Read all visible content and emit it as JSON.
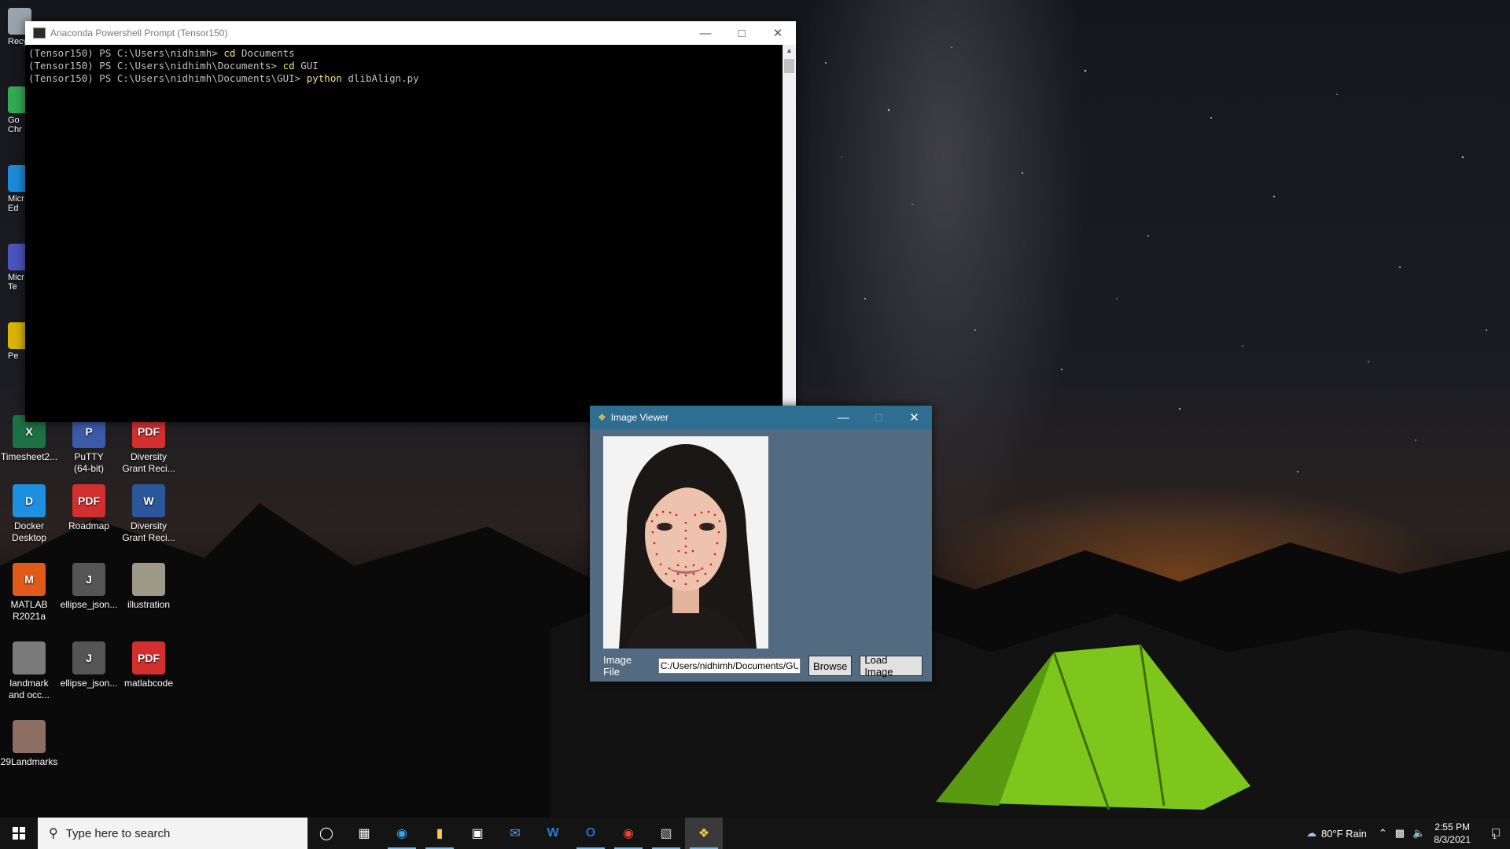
{
  "desktop": {
    "partial_icons": [
      {
        "name": "recycle-bin",
        "label": "Recy",
        "color": "#9aa4ad"
      },
      {
        "name": "google-chrome",
        "label": "Go\nChr",
        "color": "#34a853"
      },
      {
        "name": "microsoft-edge",
        "label": "Micr\nEd",
        "color": "#1b8ad8"
      },
      {
        "name": "microsoft-teams",
        "label": "Micr\nTe",
        "color": "#4b53bc"
      },
      {
        "name": "pe-app",
        "label": "Pe",
        "color": "#d9b400"
      }
    ],
    "icons": [
      {
        "label": "Timesheet2...",
        "glyph": "X",
        "color": "#1e7145"
      },
      {
        "label": "PuTTY\n(64-bit)",
        "glyph": "P",
        "color": "#3b5ba9"
      },
      {
        "label": "Diversity\nGrant Reci...",
        "glyph": "PDF",
        "color": "#d32f2f"
      },
      {
        "label": "Docker\nDesktop",
        "glyph": "D",
        "color": "#1d91e0"
      },
      {
        "label": "Roadmap",
        "glyph": "PDF",
        "color": "#d32f2f"
      },
      {
        "label": "Diversity\nGrant Reci...",
        "glyph": "W",
        "color": "#2b579a"
      },
      {
        "label": "MATLAB\nR2021a",
        "glyph": "M",
        "color": "#e05a1a"
      },
      {
        "label": "ellipse_json...",
        "glyph": "J",
        "color": "#555555"
      },
      {
        "label": "illustration",
        "glyph": "",
        "color": "#9c9a86"
      },
      {
        "label": "landmark\nand occ...",
        "glyph": "",
        "color": "#7a7a7a"
      },
      {
        "label": "ellipse_json...",
        "glyph": "J",
        "color": "#555555"
      },
      {
        "label": "matlabcode",
        "glyph": "PDF",
        "color": "#d32f2f"
      },
      {
        "label": "29Landmarks",
        "glyph": "",
        "color": "#8d6e63"
      }
    ]
  },
  "terminal": {
    "title": "Anaconda Powershell Prompt (Tensor150)",
    "lines": [
      {
        "prompt": "(Tensor150) PS C:\\Users\\nidhimh> ",
        "cmd": "cd",
        "arg": " Documents"
      },
      {
        "prompt": "(Tensor150) PS C:\\Users\\nidhimh\\Documents> ",
        "cmd": "cd",
        "arg": " GUI"
      },
      {
        "prompt": "(Tensor150) PS C:\\Users\\nidhimh\\Documents\\GUI> ",
        "cmd": "python",
        "arg": " dlibAlign.py"
      }
    ]
  },
  "viewer": {
    "title": "Image Viewer",
    "image_file_label": "Image File",
    "image_file_value": "C:/Users/nidhimh/Documents/GUI/",
    "browse_label": "Browse",
    "load_label": "Load Image"
  },
  "taskbar": {
    "search_placeholder": "Type here to search",
    "apps": [
      "edge-icon",
      "file-explorer-icon",
      "store-icon",
      "mail-icon",
      "word-icon",
      "outlook-icon",
      "chrome-icon",
      "terminal-icon",
      "python-icon"
    ],
    "weather": "80°F  Rain",
    "time": "2:55 PM",
    "date": "8/3/2021",
    "notification_count": "1"
  },
  "colors": {
    "viewer_bg": "#536b80",
    "viewer_titlebar": "#2e6e90",
    "terminal_cmd": "#f0e680",
    "taskbar_bg": "#141414"
  }
}
